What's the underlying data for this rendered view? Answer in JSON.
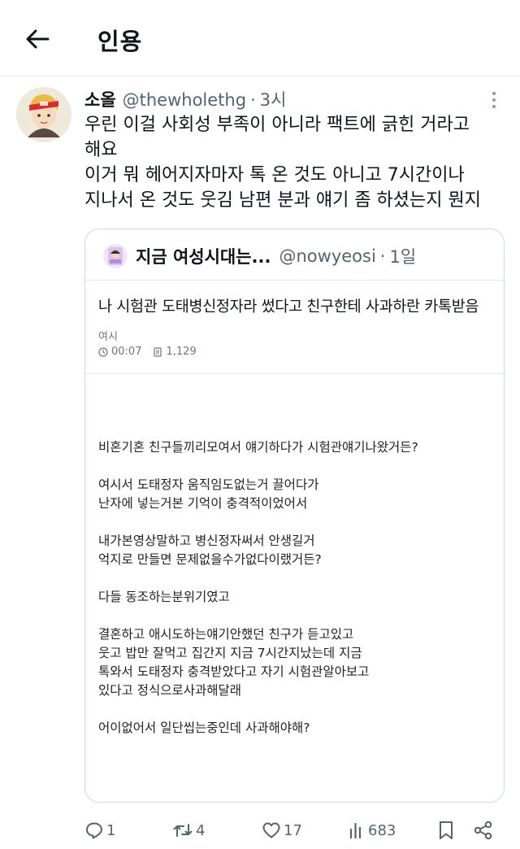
{
  "header": {
    "title": "인용"
  },
  "tweet": {
    "display_name": "소올",
    "handle": "@thewholethg",
    "separator": "·",
    "time": "3시",
    "text_lines": [
      "우린 이걸 사회성 부족이 아니라 팩트에 긁힌 거라고",
      "해요",
      "이거 뭐 헤어지자마자 톡 온 것도 아니고 7시간이나",
      "지나서 온 것도 웃김 남편 분과 얘기 좀 하셨는지 뭔지"
    ]
  },
  "quote": {
    "display_name": "지금 여성시대는...",
    "handle": "@nowyeosi",
    "separator": "·",
    "time": "1일",
    "card": {
      "title": "나 시험관 도태병신정자라 썼다고 친구한테 사과하란 카톡받음",
      "board": "여시",
      "time": "00:07",
      "views": "1,129",
      "body": [
        "비혼기혼 친구들끼리모여서 얘기하다가 시험관얘기나왔거든?",
        "",
        "여시서 도태정자 움직임도없는거 끌어다가",
        "난자에 넣는거본 기억이 충격적이었어서",
        "",
        "내가본영상말하고 병신정자써서 안생길거",
        "억지로 만들면 문제없을수가없다이랬거든?",
        "",
        "다들 동조하는분위기였고",
        "",
        "결혼하고 애시도하는얘기안했던 친구가 듣고있고",
        "웃고 밥만 잘먹고 집간지 지금 7시간지났는데 지금",
        "톡와서 도태정자 충격받았다고 자기 시험관알아보고",
        "있다고 정식으로사과해달래",
        "",
        "어이없어서 일단씹는중인데 사과해야해?"
      ]
    }
  },
  "actions": {
    "replies": "1",
    "retweets": "4",
    "likes": "17",
    "views": "683"
  },
  "colors": {
    "text": "#0f1419",
    "muted": "#536471",
    "border": "#cfd9de"
  }
}
